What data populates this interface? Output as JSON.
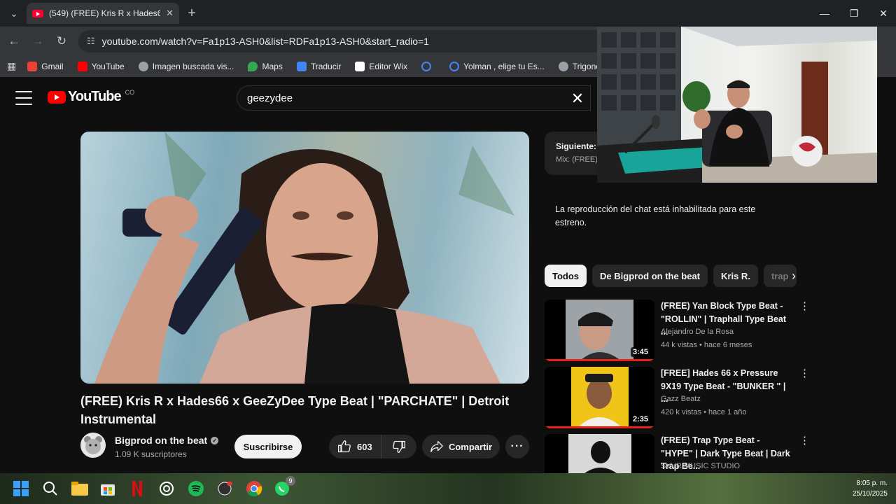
{
  "browser": {
    "tab_title": "(549) (FREE) Kris R x Hades66 x",
    "url": "youtube.com/watch?v=Fa1p13-ASH0&list=RDFa1p13-ASH0&start_radio=1",
    "bookmarks": [
      {
        "label": "Gmail",
        "color": "#ea4335"
      },
      {
        "label": "YouTube",
        "color": "#ff0000"
      },
      {
        "label": "Imagen buscada vis...",
        "color": "#9aa0a6"
      },
      {
        "label": "Maps",
        "color": "#34a853"
      },
      {
        "label": "Traducir",
        "color": "#4285f4"
      },
      {
        "label": "Editor Wix",
        "color": "#ffffff"
      },
      {
        "label": "",
        "color": "#4285f4"
      },
      {
        "label": "Yolman , elige tu Es...",
        "color": "#4285f4"
      },
      {
        "label": "Trigonometría",
        "color": "#9aa0a6"
      }
    ]
  },
  "youtube": {
    "logo_text": "YouTube",
    "country_code": "CO",
    "search_value": "geezydee",
    "video": {
      "title": "(FREE) Kris R x Hades66 x GeeZyDee Type Beat | \"PARCHATE\" | Detroit Instrumental",
      "channel": "Bigprod on the beat",
      "subscribers": "1.09 K suscriptores",
      "subscribe_label": "Suscribirse",
      "likes": "603",
      "share_label": "Compartir",
      "more_label": "···"
    },
    "next": {
      "label": "Siguiente:",
      "subtitle": "Mix: (FREE)"
    },
    "chat_message": "La reproducción del chat está inhabilitada para este estreno.",
    "chips": [
      "Todos",
      "De Bigprod on the beat",
      "Kris R.",
      "trap"
    ],
    "recommendations": [
      {
        "title": "(FREE) Yan Block Type Beat - \"ROLLIN\" | Traphall Type Beat ...",
        "channel": "Alejandro De la Rosa",
        "meta": "44 k vistas • hace 6 meses",
        "duration": "3:45",
        "progress": 1.0
      },
      {
        "title": "[FREE] Hades 66 x Pressure 9X19 Type Beat - \"BUNKER \" | ...",
        "channel": "Gazz Beatz",
        "meta": "420 k vistas • hace 1 año",
        "duration": "2:35",
        "progress": 1.0
      },
      {
        "title": "(FREE) Trap Type Beat - \"HYPE\" | Dark Type Beat | Dark Trap Be...",
        "channel": "SYVR MUSIC STUDIO",
        "meta": "",
        "duration": "",
        "progress": 0
      }
    ]
  },
  "taskbar": {
    "time": "8:05 p. m.",
    "date": "25/10/2025",
    "whatsapp_badge": "9"
  }
}
